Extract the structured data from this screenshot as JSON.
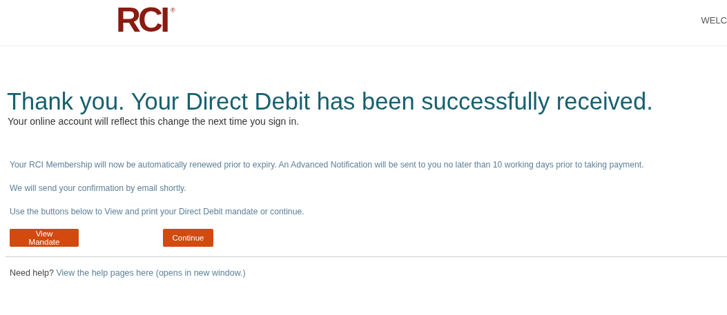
{
  "header": {
    "logo": "RCI",
    "logo_mark": "®",
    "welcome": "WELC"
  },
  "heading": "Thank you. Your Direct Debit has been successfully received.",
  "subheading": "Your online account will reflect this change the next time you sign in.",
  "paragraphs": [
    "Your RCI Membership will now be automatically renewed prior to expiry. An Advanced Notification will be sent to you no later than 10 working days prior to taking payment.",
    "We will send your confirmation by email shortly.",
    "Use the buttons below to View and print your Direct Debit mandate or continue."
  ],
  "buttons": [
    "View Mandate",
    "Continue"
  ],
  "help": {
    "label": "Need help?",
    "link": "View the help pages here (opens in new window.)"
  }
}
